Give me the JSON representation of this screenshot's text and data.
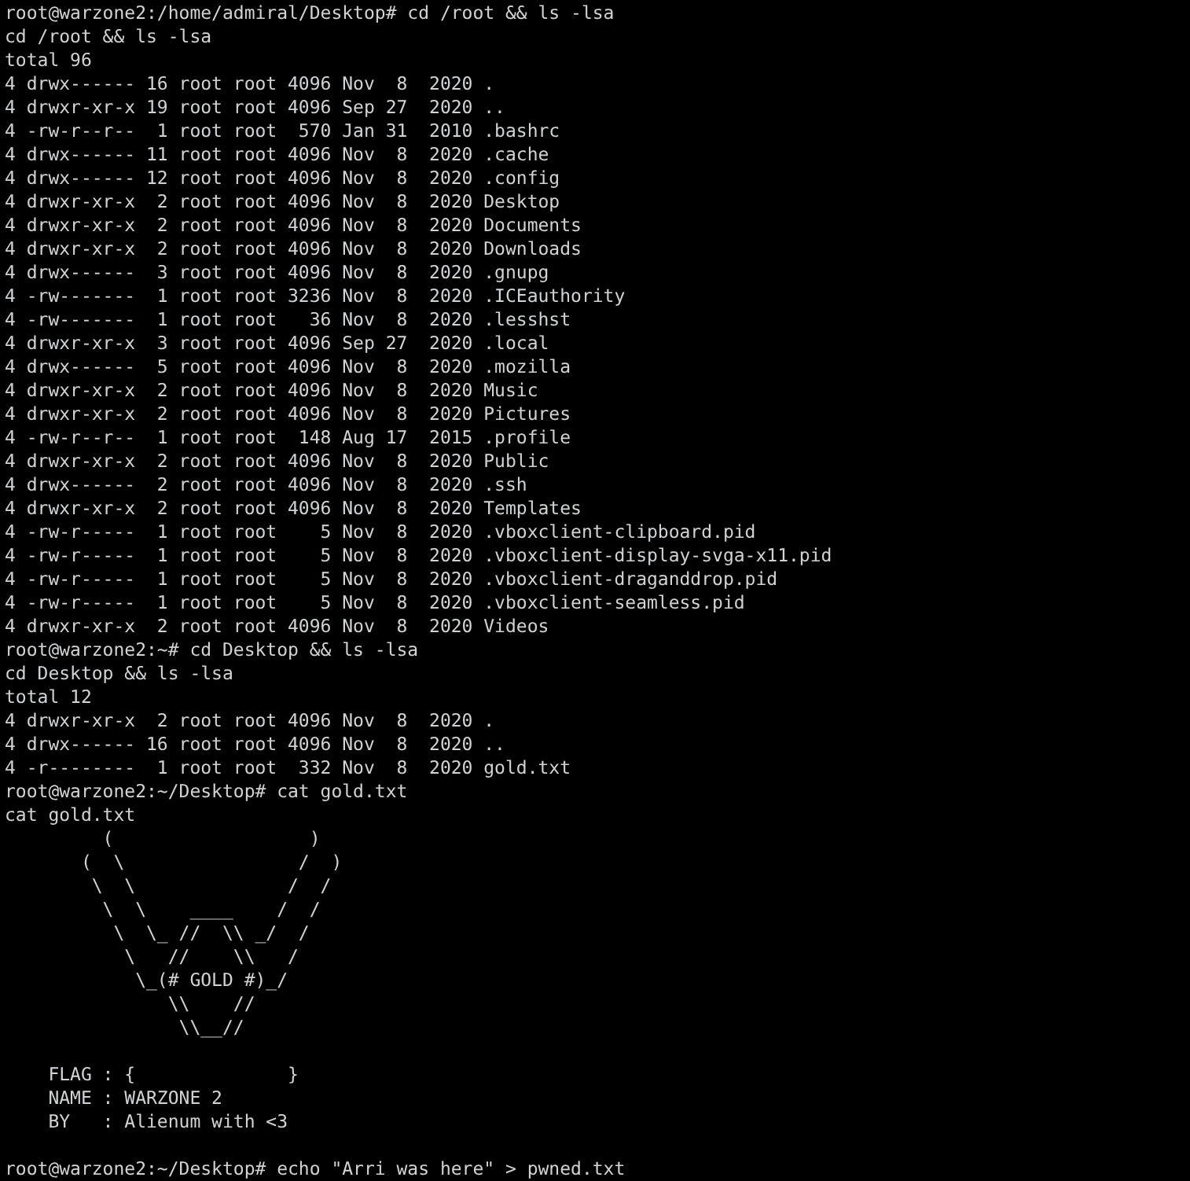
{
  "terminal": {
    "entries": [
      {
        "kind": "prompt",
        "text": "root@warzone2:/home/admiral/Desktop# cd /root && ls -lsa"
      },
      {
        "kind": "output",
        "lines": [
          "cd /root && ls -lsa",
          "total 96",
          "4 drwx------ 16 root root 4096 Nov  8  2020 .",
          "4 drwxr-xr-x 19 root root 4096 Sep 27  2020 ..",
          "4 -rw-r--r--  1 root root  570 Jan 31  2010 .bashrc",
          "4 drwx------ 11 root root 4096 Nov  8  2020 .cache",
          "4 drwx------ 12 root root 4096 Nov  8  2020 .config",
          "4 drwxr-xr-x  2 root root 4096 Nov  8  2020 Desktop",
          "4 drwxr-xr-x  2 root root 4096 Nov  8  2020 Documents",
          "4 drwxr-xr-x  2 root root 4096 Nov  8  2020 Downloads",
          "4 drwx------  3 root root 4096 Nov  8  2020 .gnupg",
          "4 -rw-------  1 root root 3236 Nov  8  2020 .ICEauthority",
          "4 -rw-------  1 root root   36 Nov  8  2020 .lesshst",
          "4 drwxr-xr-x  3 root root 4096 Sep 27  2020 .local",
          "4 drwx------  5 root root 4096 Nov  8  2020 .mozilla",
          "4 drwxr-xr-x  2 root root 4096 Nov  8  2020 Music",
          "4 drwxr-xr-x  2 root root 4096 Nov  8  2020 Pictures",
          "4 -rw-r--r--  1 root root  148 Aug 17  2015 .profile",
          "4 drwxr-xr-x  2 root root 4096 Nov  8  2020 Public",
          "4 drwx------  2 root root 4096 Nov  8  2020 .ssh",
          "4 drwxr-xr-x  2 root root 4096 Nov  8  2020 Templates",
          "4 -rw-r-----  1 root root    5 Nov  8  2020 .vboxclient-clipboard.pid",
          "4 -rw-r-----  1 root root    5 Nov  8  2020 .vboxclient-display-svga-x11.pid",
          "4 -rw-r-----  1 root root    5 Nov  8  2020 .vboxclient-draganddrop.pid",
          "4 -rw-r-----  1 root root    5 Nov  8  2020 .vboxclient-seamless.pid",
          "4 drwxr-xr-x  2 root root 4096 Nov  8  2020 Videos"
        ]
      },
      {
        "kind": "prompt",
        "text": "root@warzone2:~# cd Desktop && ls -lsa"
      },
      {
        "kind": "output",
        "lines": [
          "cd Desktop && ls -lsa",
          "total 12",
          "4 drwxr-xr-x  2 root root 4096 Nov  8  2020 .",
          "4 drwx------ 16 root root 4096 Nov  8  2020 ..",
          "4 -r--------  1 root root  332 Nov  8  2020 gold.txt"
        ]
      },
      {
        "kind": "prompt",
        "text": "root@warzone2:~/Desktop# cat gold.txt"
      },
      {
        "kind": "output",
        "lines": [
          "cat gold.txt"
        ]
      },
      {
        "kind": "art",
        "lines": [
          "         (                  )",
          "       (  \\                /  )",
          "        \\  \\              /  /",
          "         \\  \\    ____    /  /",
          "          \\  \\_ //  \\\\ _/  /",
          "           \\   //    \\\\   /",
          "            \\_(# GOLD #)_/",
          "               \\\\    //",
          "                \\\\__//"
        ]
      },
      {
        "kind": "info",
        "lines": [
          "    FLAG : {              }",
          "    NAME : WARZONE 2",
          "    BY   : Alienum with <3"
        ]
      },
      {
        "kind": "prompt",
        "text": "root@warzone2:~/Desktop# echo \"Arri was here\" > pwned.txt"
      }
    ]
  }
}
